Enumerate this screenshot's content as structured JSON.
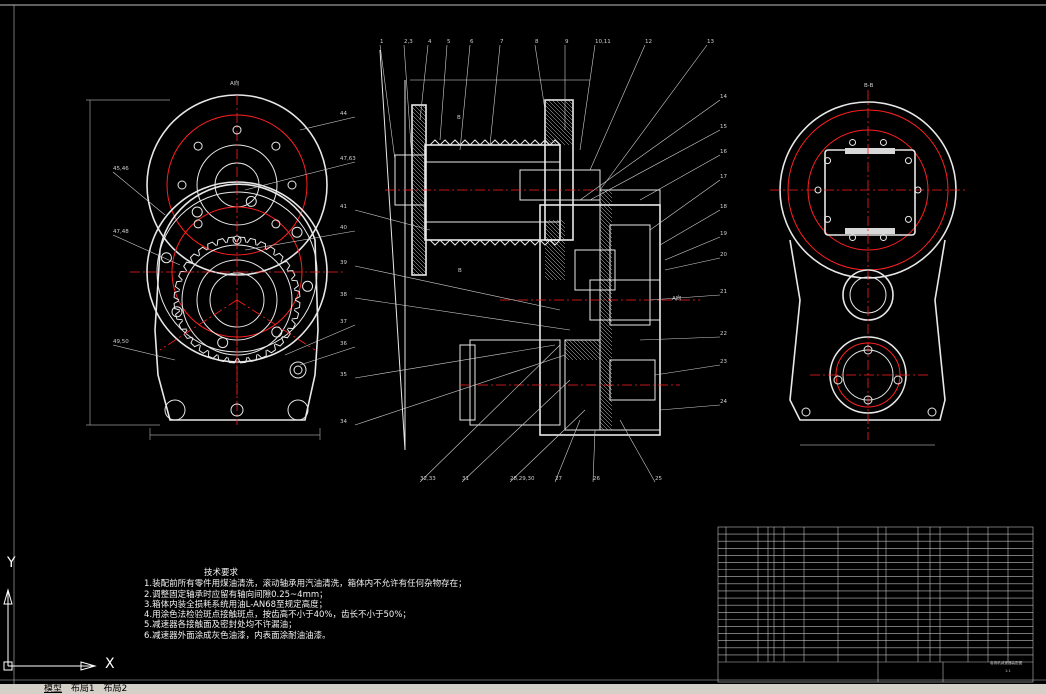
{
  "notes": {
    "title": "技术要求",
    "lines": [
      "1.装配前所有零件用煤油清洗，滚动轴承用汽油清洗，箱体内不允许有任何杂物存在；",
      "2.调整固定轴承时应留有轴向间隙0.25~4mm；",
      "3.箱体内装全损耗系统用油L-AN68至规定高度；",
      "4.用涂色法检验斑点接触斑点，按齿高不小于40%，齿长不小于50%；",
      "5.减速器各接触面及密封处均不许漏油；",
      "6.减速器外面涂成灰色油漆，内表面涂耐油油漆。"
    ]
  },
  "views": {
    "left_view_label": "A向",
    "right_view_label": "B-B",
    "section_marker": "B",
    "section_marker_arrow": "A向",
    "left_callouts": [
      "44",
      "45,46",
      "47,63",
      "47,48",
      "40",
      "39",
      "38",
      "37",
      "36",
      "35",
      "34",
      "41",
      "49,50"
    ],
    "top_callouts": [
      "1",
      "2,3",
      "4",
      "5",
      "6",
      "7",
      "8",
      "9",
      "10,11",
      "12",
      "13"
    ],
    "right_callouts": [
      "14",
      "15",
      "16",
      "17",
      "18",
      "19",
      "20",
      "21",
      "22",
      "23",
      "24"
    ],
    "bottom_callouts": [
      "32,33",
      "31",
      "28,29,30",
      "27",
      "26",
      "25"
    ]
  },
  "axes": {
    "y_label": "Y",
    "x_label": "X"
  },
  "tabs": [
    {
      "label": "模型",
      "active": true
    },
    {
      "label": "布局1",
      "active": false
    },
    {
      "label": "布局2",
      "active": false
    }
  ],
  "title_block": {
    "title": "卷扬机减速器装配图",
    "scale": "1:1"
  }
}
